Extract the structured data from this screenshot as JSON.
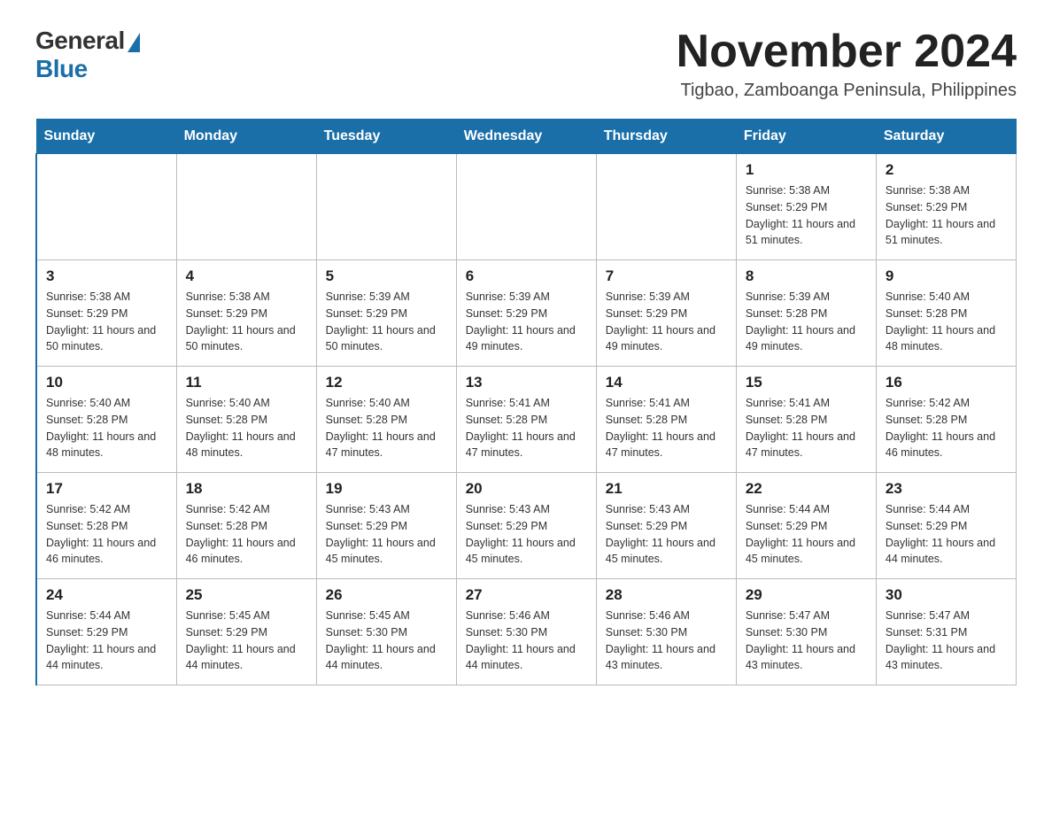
{
  "header": {
    "logo": {
      "general": "General",
      "blue": "Blue"
    },
    "title": "November 2024",
    "location": "Tigbao, Zamboanga Peninsula, Philippines"
  },
  "days_of_week": [
    "Sunday",
    "Monday",
    "Tuesday",
    "Wednesday",
    "Thursday",
    "Friday",
    "Saturday"
  ],
  "weeks": [
    [
      {
        "day": "",
        "sunrise": "",
        "sunset": "",
        "daylight": ""
      },
      {
        "day": "",
        "sunrise": "",
        "sunset": "",
        "daylight": ""
      },
      {
        "day": "",
        "sunrise": "",
        "sunset": "",
        "daylight": ""
      },
      {
        "day": "",
        "sunrise": "",
        "sunset": "",
        "daylight": ""
      },
      {
        "day": "",
        "sunrise": "",
        "sunset": "",
        "daylight": ""
      },
      {
        "day": "1",
        "sunrise": "Sunrise: 5:38 AM",
        "sunset": "Sunset: 5:29 PM",
        "daylight": "Daylight: 11 hours and 51 minutes."
      },
      {
        "day": "2",
        "sunrise": "Sunrise: 5:38 AM",
        "sunset": "Sunset: 5:29 PM",
        "daylight": "Daylight: 11 hours and 51 minutes."
      }
    ],
    [
      {
        "day": "3",
        "sunrise": "Sunrise: 5:38 AM",
        "sunset": "Sunset: 5:29 PM",
        "daylight": "Daylight: 11 hours and 50 minutes."
      },
      {
        "day": "4",
        "sunrise": "Sunrise: 5:38 AM",
        "sunset": "Sunset: 5:29 PM",
        "daylight": "Daylight: 11 hours and 50 minutes."
      },
      {
        "day": "5",
        "sunrise": "Sunrise: 5:39 AM",
        "sunset": "Sunset: 5:29 PM",
        "daylight": "Daylight: 11 hours and 50 minutes."
      },
      {
        "day": "6",
        "sunrise": "Sunrise: 5:39 AM",
        "sunset": "Sunset: 5:29 PM",
        "daylight": "Daylight: 11 hours and 49 minutes."
      },
      {
        "day": "7",
        "sunrise": "Sunrise: 5:39 AM",
        "sunset": "Sunset: 5:29 PM",
        "daylight": "Daylight: 11 hours and 49 minutes."
      },
      {
        "day": "8",
        "sunrise": "Sunrise: 5:39 AM",
        "sunset": "Sunset: 5:28 PM",
        "daylight": "Daylight: 11 hours and 49 minutes."
      },
      {
        "day": "9",
        "sunrise": "Sunrise: 5:40 AM",
        "sunset": "Sunset: 5:28 PM",
        "daylight": "Daylight: 11 hours and 48 minutes."
      }
    ],
    [
      {
        "day": "10",
        "sunrise": "Sunrise: 5:40 AM",
        "sunset": "Sunset: 5:28 PM",
        "daylight": "Daylight: 11 hours and 48 minutes."
      },
      {
        "day": "11",
        "sunrise": "Sunrise: 5:40 AM",
        "sunset": "Sunset: 5:28 PM",
        "daylight": "Daylight: 11 hours and 48 minutes."
      },
      {
        "day": "12",
        "sunrise": "Sunrise: 5:40 AM",
        "sunset": "Sunset: 5:28 PM",
        "daylight": "Daylight: 11 hours and 47 minutes."
      },
      {
        "day": "13",
        "sunrise": "Sunrise: 5:41 AM",
        "sunset": "Sunset: 5:28 PM",
        "daylight": "Daylight: 11 hours and 47 minutes."
      },
      {
        "day": "14",
        "sunrise": "Sunrise: 5:41 AM",
        "sunset": "Sunset: 5:28 PM",
        "daylight": "Daylight: 11 hours and 47 minutes."
      },
      {
        "day": "15",
        "sunrise": "Sunrise: 5:41 AM",
        "sunset": "Sunset: 5:28 PM",
        "daylight": "Daylight: 11 hours and 47 minutes."
      },
      {
        "day": "16",
        "sunrise": "Sunrise: 5:42 AM",
        "sunset": "Sunset: 5:28 PM",
        "daylight": "Daylight: 11 hours and 46 minutes."
      }
    ],
    [
      {
        "day": "17",
        "sunrise": "Sunrise: 5:42 AM",
        "sunset": "Sunset: 5:28 PM",
        "daylight": "Daylight: 11 hours and 46 minutes."
      },
      {
        "day": "18",
        "sunrise": "Sunrise: 5:42 AM",
        "sunset": "Sunset: 5:28 PM",
        "daylight": "Daylight: 11 hours and 46 minutes."
      },
      {
        "day": "19",
        "sunrise": "Sunrise: 5:43 AM",
        "sunset": "Sunset: 5:29 PM",
        "daylight": "Daylight: 11 hours and 45 minutes."
      },
      {
        "day": "20",
        "sunrise": "Sunrise: 5:43 AM",
        "sunset": "Sunset: 5:29 PM",
        "daylight": "Daylight: 11 hours and 45 minutes."
      },
      {
        "day": "21",
        "sunrise": "Sunrise: 5:43 AM",
        "sunset": "Sunset: 5:29 PM",
        "daylight": "Daylight: 11 hours and 45 minutes."
      },
      {
        "day": "22",
        "sunrise": "Sunrise: 5:44 AM",
        "sunset": "Sunset: 5:29 PM",
        "daylight": "Daylight: 11 hours and 45 minutes."
      },
      {
        "day": "23",
        "sunrise": "Sunrise: 5:44 AM",
        "sunset": "Sunset: 5:29 PM",
        "daylight": "Daylight: 11 hours and 44 minutes."
      }
    ],
    [
      {
        "day": "24",
        "sunrise": "Sunrise: 5:44 AM",
        "sunset": "Sunset: 5:29 PM",
        "daylight": "Daylight: 11 hours and 44 minutes."
      },
      {
        "day": "25",
        "sunrise": "Sunrise: 5:45 AM",
        "sunset": "Sunset: 5:29 PM",
        "daylight": "Daylight: 11 hours and 44 minutes."
      },
      {
        "day": "26",
        "sunrise": "Sunrise: 5:45 AM",
        "sunset": "Sunset: 5:30 PM",
        "daylight": "Daylight: 11 hours and 44 minutes."
      },
      {
        "day": "27",
        "sunrise": "Sunrise: 5:46 AM",
        "sunset": "Sunset: 5:30 PM",
        "daylight": "Daylight: 11 hours and 44 minutes."
      },
      {
        "day": "28",
        "sunrise": "Sunrise: 5:46 AM",
        "sunset": "Sunset: 5:30 PM",
        "daylight": "Daylight: 11 hours and 43 minutes."
      },
      {
        "day": "29",
        "sunrise": "Sunrise: 5:47 AM",
        "sunset": "Sunset: 5:30 PM",
        "daylight": "Daylight: 11 hours and 43 minutes."
      },
      {
        "day": "30",
        "sunrise": "Sunrise: 5:47 AM",
        "sunset": "Sunset: 5:31 PM",
        "daylight": "Daylight: 11 hours and 43 minutes."
      }
    ]
  ]
}
